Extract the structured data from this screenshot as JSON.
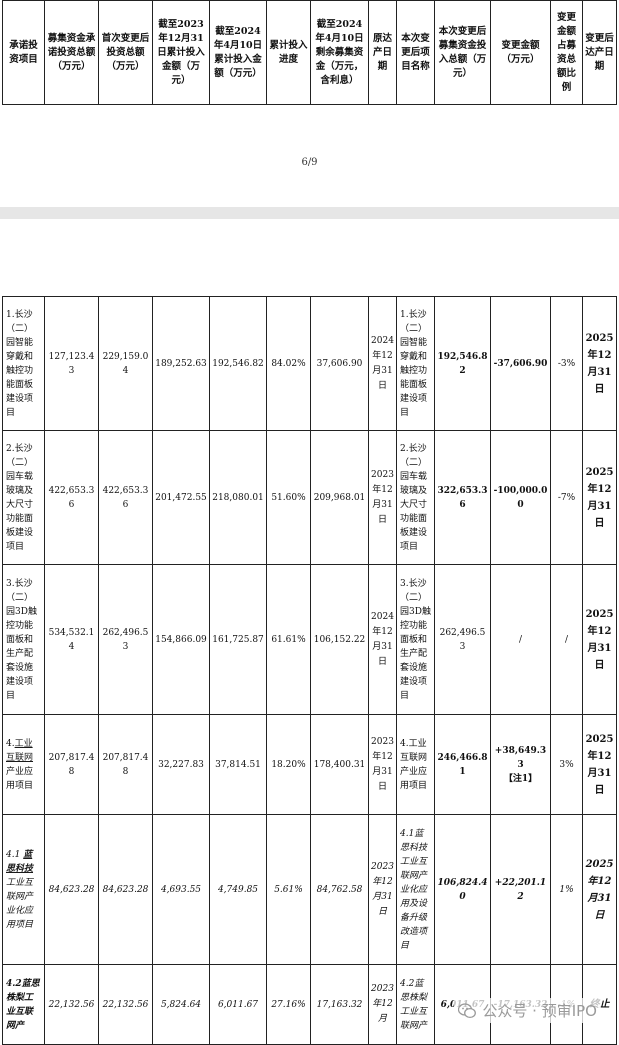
{
  "header": {
    "columns": [
      "承诺投资项目",
      "募集资金承诺投资总额（万元）",
      "首次变更后投资总额（万元）",
      "截至2023年12月31日累计投入金额（万元）",
      "截至2024年4月10日累计投入金额（万元）",
      "累计投入进度",
      "截至2024年4月10日剩余募集资金（万元，含利息）",
      "原达产日期",
      "本次变更后项目名称",
      "本次变更后募集资金投入总额（万元）",
      "变更金额（万元）",
      "变更金额占募资总额比例",
      "变更后达产日期"
    ]
  },
  "page_number": "6/9",
  "rows": [
    {
      "project": "1.长沙（二）园智能穿戴和触控功能面板建设项目",
      "committed": "127,123.43",
      "first_change": "229,159.04",
      "cum_2023": "189,252.63",
      "cum_2024": "192,546.82",
      "progress": "84.02%",
      "remaining": "37,606.90",
      "orig_date": "2024年12月31日",
      "new_name": "1.长沙（二）园智能穿戴和触控功能面板建设项目",
      "new_total": "192,546.82",
      "change": "-37,606.90",
      "ratio": "-3%",
      "new_date": "2025年12月31日"
    },
    {
      "project": "2.长沙（二）园车载玻璃及大尺寸功能面板建设项目",
      "committed": "422,653.36",
      "first_change": "422,653.36",
      "cum_2023": "201,472.55",
      "cum_2024": "218,080.01",
      "progress": "51.60%",
      "remaining": "209,968.01",
      "orig_date": "2023年12月31日",
      "new_name": "2.长沙（二）园车载玻璃及大尺寸功能面板建设项目",
      "new_total": "322,653.36",
      "change": "-100,000.00",
      "ratio": "-7%",
      "new_date": "2025年12月31日"
    },
    {
      "project": "3.长沙（二）园3D触控功能面板和生产配套设施建设项目",
      "committed": "534,532.14",
      "first_change": "262,496.53",
      "cum_2023": "154,866.09",
      "cum_2024": "161,725.87",
      "progress": "61.61%",
      "remaining": "106,152.22",
      "orig_date": "2024年12月31日",
      "new_name": "3.长沙（二）园3D触控功能面板和生产配套设施建设项目",
      "new_total": "262,496.53",
      "change": "/",
      "ratio": "/",
      "new_date": "2025年12月31日"
    },
    {
      "project_prefix": "4.",
      "project_link": "工业互联网",
      "project_suffix": "产业应用项目",
      "committed": "207,817.48",
      "first_change": "207,817.48",
      "cum_2023": "32,227.83",
      "cum_2024": "37,814.51",
      "progress": "18.20%",
      "remaining": "178,400.31",
      "orig_date": "2023年12月31日",
      "new_name": "4.工业互联网产业应用项目",
      "new_total": "246,466.81",
      "change": "+38,649.33",
      "change_note": "【注1】",
      "ratio": "3%",
      "new_date": "2025年12月31日"
    },
    {
      "project_prefix": "4.1 ",
      "project_link": "蓝思科技",
      "project_suffix": "工业互联网产业化应用项目",
      "committed": "84,623.28",
      "first_change": "84,623.28",
      "cum_2023": "4,693.55",
      "cum_2024": "4,749.85",
      "progress": "5.61%",
      "remaining": "84,762.58",
      "orig_date": "2023年12月31日",
      "new_name": "4.1蓝思科技工业互联网产业化应用及设备升级改造项目",
      "new_total": "106,824.40",
      "change": "+22,201.12",
      "ratio": "1%",
      "new_date": "2025年12月31日"
    },
    {
      "project": "4.2蓝思株梨工业互联网产",
      "committed": "22,132.56",
      "first_change": "22,132.56",
      "cum_2023": "5,824.64",
      "cum_2024": "6,011.67",
      "progress": "27.16%",
      "remaining": "17,163.32",
      "orig_date": "2023年12月",
      "new_name": "4.2蓝思株梨工业互联网产",
      "new_total": "6,011.67",
      "change": "-17,163.32",
      "ratio": "-1%",
      "new_date": "终止"
    }
  ],
  "watermark": {
    "text": "公众号 · 预审IPO",
    "icon": "wechat-icon"
  }
}
